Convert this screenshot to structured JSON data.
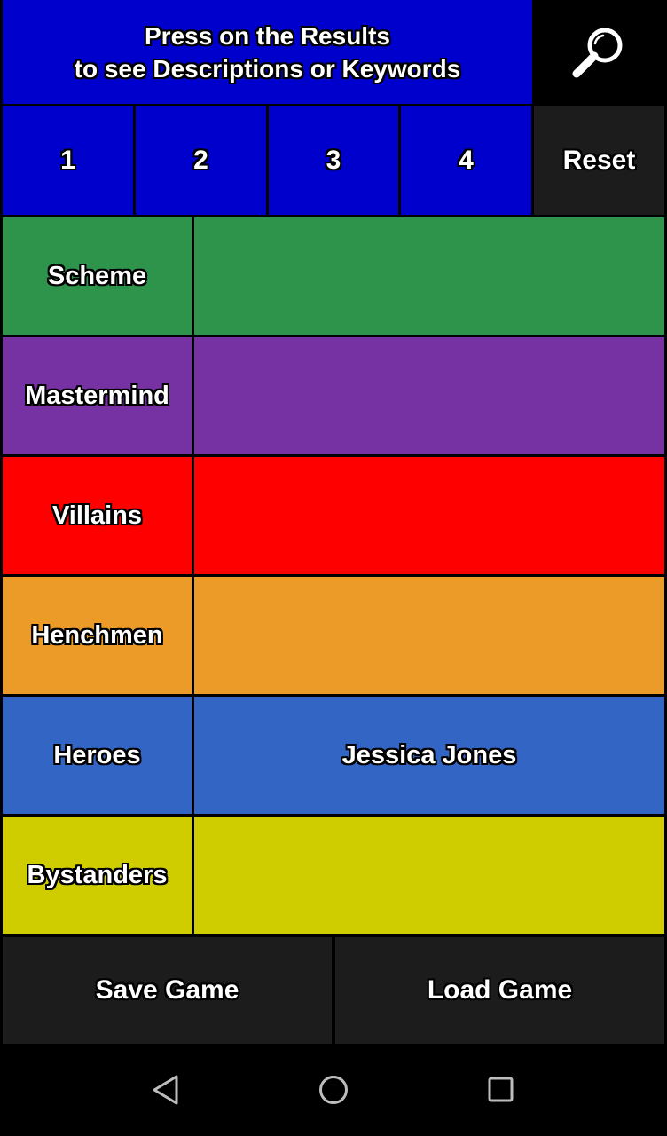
{
  "header": {
    "line1": "Press on the Results",
    "line2": "to see Descriptions or Keywords",
    "search_icon": "magnifier-icon"
  },
  "players": {
    "buttons": [
      "1",
      "2",
      "3",
      "4"
    ],
    "reset_label": "Reset"
  },
  "categories": [
    {
      "label": "Scheme",
      "result": "",
      "color": "#2e944b"
    },
    {
      "label": "Mastermind",
      "result": "",
      "color": "#7632a3"
    },
    {
      "label": "Villains",
      "result": "",
      "color": "#ff0000"
    },
    {
      "label": "Henchmen",
      "result": "",
      "color": "#ec9a28"
    },
    {
      "label": "Heroes",
      "result": "Jessica Jones",
      "color": "#3366c4"
    },
    {
      "label": "Bystanders",
      "result": "",
      "color": "#cfcd00"
    }
  ],
  "footer": {
    "save_label": "Save Game",
    "load_label": "Load Game"
  },
  "navbar": {
    "back_icon": "back-triangle-icon",
    "home_icon": "home-circle-icon",
    "recents_icon": "recents-square-icon"
  },
  "colors": {
    "header_blue": "#0000cc",
    "dark_button": "#1c1c1c"
  }
}
